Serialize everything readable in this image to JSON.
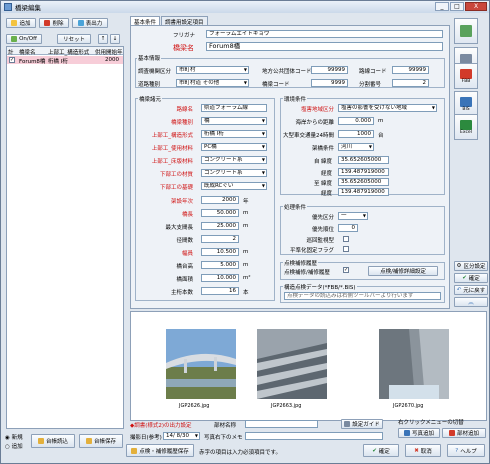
{
  "window": {
    "title": "橋梁編集",
    "min": "_",
    "max": "□",
    "close": "X"
  },
  "toolbar": {
    "add": "追加",
    "delete": "削除",
    "output": "表出力",
    "onoff": "On/Off",
    "reset": "リセット"
  },
  "list": {
    "headers": [
      "計",
      "橋梁名",
      "上部工_構造形式",
      "供用開始年"
    ],
    "rows": [
      {
        "check": "✓",
        "name": "Forum8橋",
        "struct": "桁橋 I桁",
        "year": "2000"
      }
    ]
  },
  "bottom_left": {
    "radio_new": "新規",
    "radio_add": "追加",
    "read": "台帳読込",
    "save": "台帳保存"
  },
  "tabs": {
    "basic": "基本条件",
    "survey": "調書用設定項目"
  },
  "basic": {
    "furigana_label": "フリガナ",
    "furigana": "フォーラムエイトキョウ",
    "name_label": "橋梁名",
    "name": "Forum8橋",
    "info_title": "基本情報",
    "admin_label": "調査機関区分",
    "admin": "市町村",
    "lgcode_label": "地方公共団体コード",
    "lgcode": "99999",
    "route_code_label": "路線コード",
    "route_code": "99999",
    "road_label": "道路種別",
    "road": "市町村道 その他",
    "bridge_code_label": "橋梁コード",
    "bridge_code": "9999",
    "section_label": "分割番号",
    "section": "2"
  },
  "specs": {
    "title": "橋梁諸元",
    "route_label": "路線名",
    "route": "県道フォーラム線",
    "type_label": "橋梁種別",
    "type": "橋",
    "struct_label": "上部工_構造形式",
    "struct": "桁橋 I桁",
    "material_label": "上部工_使用材料",
    "material": "PC橋",
    "deck_label": "上部工_床版材料",
    "deck": "コンクリート系",
    "sub_label": "下部工の材質",
    "sub": "コンクリート系",
    "found_label": "下部工の基礎",
    "found": "既成RCぐい",
    "year_label": "架設年次",
    "year": "2000",
    "year_unit": "年",
    "length_label": "橋長",
    "length": "50.000",
    "length_unit": "m",
    "span_label": "最大支間長",
    "span": "25.000",
    "span_unit": "m",
    "nspans_label": "径間数",
    "nspans": "2",
    "width_label": "幅員",
    "width": "10.500",
    "width_unit": "m",
    "height_label": "橋台高",
    "height": "5.000",
    "height_unit": "m",
    "area_label": "橋面積",
    "area": "10.000",
    "area_unit": "m²",
    "girders_label": "主桁本数",
    "girders": "16",
    "girders_unit": "本"
  },
  "env": {
    "title": "環境条件",
    "salt_label": "塩害地域区分",
    "salt": "塩害の影響を受けない地域",
    "sea_label": "海岸からの距離",
    "sea": "0.000",
    "sea_unit": "m",
    "traffic_label": "大型車交通量24時間",
    "traffic": "1000",
    "traffic_unit": "台",
    "cross_label": "架橋条件",
    "cross": "河川",
    "start_label": "自",
    "lat_label": "緯度",
    "lon_label": "経度",
    "lat1": "35.652605000",
    "lon1": "139.487919000",
    "end_label": "至",
    "lat2": "35.652605000",
    "lon2": "139.487919000"
  },
  "proc": {
    "title": "処理条件",
    "priority_label": "優先区分",
    "priority": "一",
    "order_label": "優先順位",
    "order": "0",
    "watch_label": "巡回監視型",
    "flag_label": "平準化固定フラグ"
  },
  "inspect": {
    "title": "点検補修履歴",
    "repair_label": "点検補修/補修履歴",
    "repair_check": "✓",
    "detail_btn": "点検/補修詳細設定",
    "data_title": "構造点検データ(*FBB/*.BIS)",
    "data_hint": "点検データの読込みは右側ツールバーより行います"
  },
  "sidebar": {
    "fbb": "FBB",
    "bis": "BIS",
    "excel": "Excel"
  },
  "right_btns": {
    "settings": "区分設定",
    "ok": "確定",
    "back": "元に戻す"
  },
  "photos": [
    {
      "caption": "JGP2626.jpg"
    },
    {
      "caption": "JGP2663.jpg"
    },
    {
      "caption": "JGP2670.jpg"
    }
  ],
  "photo_panel": {
    "output_label": "◆調書(様式2)の出力設定",
    "dept_label": "部材名称",
    "date_label": "撮影日(参考)",
    "date": "14/ 8/30",
    "memo_label": "写真右下のメモ",
    "guide_btn": "設定ガイド",
    "menu_label": "右クリックメニューの切替",
    "add_photo": "写真追加",
    "member_add": "部材追加"
  },
  "footer": {
    "status": "赤字の項目は入力必須項目です。",
    "print": "点検・補修履歴保存",
    "ok": "確定",
    "cancel": "取消",
    "help": "ヘルプ"
  },
  "colors": {
    "accent_red": "#d01010",
    "selected_row": "#f7cdd8"
  }
}
